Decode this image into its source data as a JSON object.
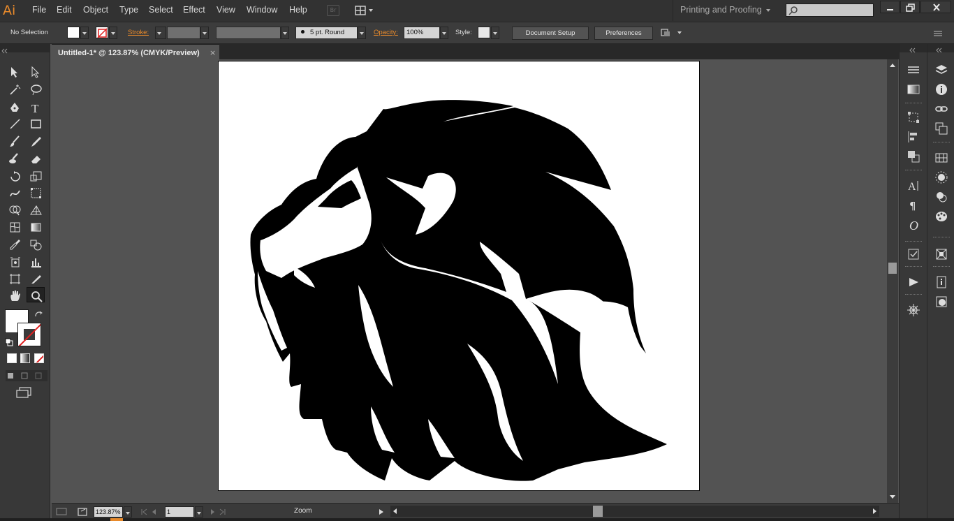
{
  "app": {
    "logo": "Ai",
    "accent": "#e88a2b"
  },
  "menu": {
    "items": [
      "File",
      "Edit",
      "Object",
      "Type",
      "Select",
      "Effect",
      "View",
      "Window",
      "Help"
    ],
    "bridge_label": "Br",
    "workspace": "Printing and Proofing"
  },
  "control": {
    "selection": "No Selection",
    "stroke_label": "Stroke:",
    "brush": "5 pt. Round",
    "opacity_label": "Opacity:",
    "opacity_value": "100%",
    "style_label": "Style:",
    "document_setup": "Document Setup",
    "preferences": "Preferences"
  },
  "document": {
    "tab_title": "Untitled-1* @ 123.87% (CMYK/Preview)",
    "tab_close": "×"
  },
  "status": {
    "zoom": "123.87%",
    "page": "1",
    "tool_name": "Zoom"
  },
  "tools": [
    "selection-tool",
    "direct-selection-tool",
    "magic-wand-tool",
    "lasso-tool",
    "pen-tool",
    "type-tool",
    "line-segment-tool",
    "rectangle-tool",
    "paintbrush-tool",
    "pencil-tool",
    "blob-brush-tool",
    "eraser-tool",
    "rotate-tool",
    "scale-tool",
    "warp-tool",
    "free-transform-tool",
    "shape-builder-tool",
    "perspective-grid-tool",
    "mesh-tool",
    "gradient-tool",
    "eyedropper-tool",
    "blend-tool",
    "symbol-sprayer-tool",
    "column-graph-tool",
    "artboard-tool",
    "slice-tool",
    "hand-tool",
    "zoom-tool"
  ],
  "artwork": "lion-head-silhouette"
}
